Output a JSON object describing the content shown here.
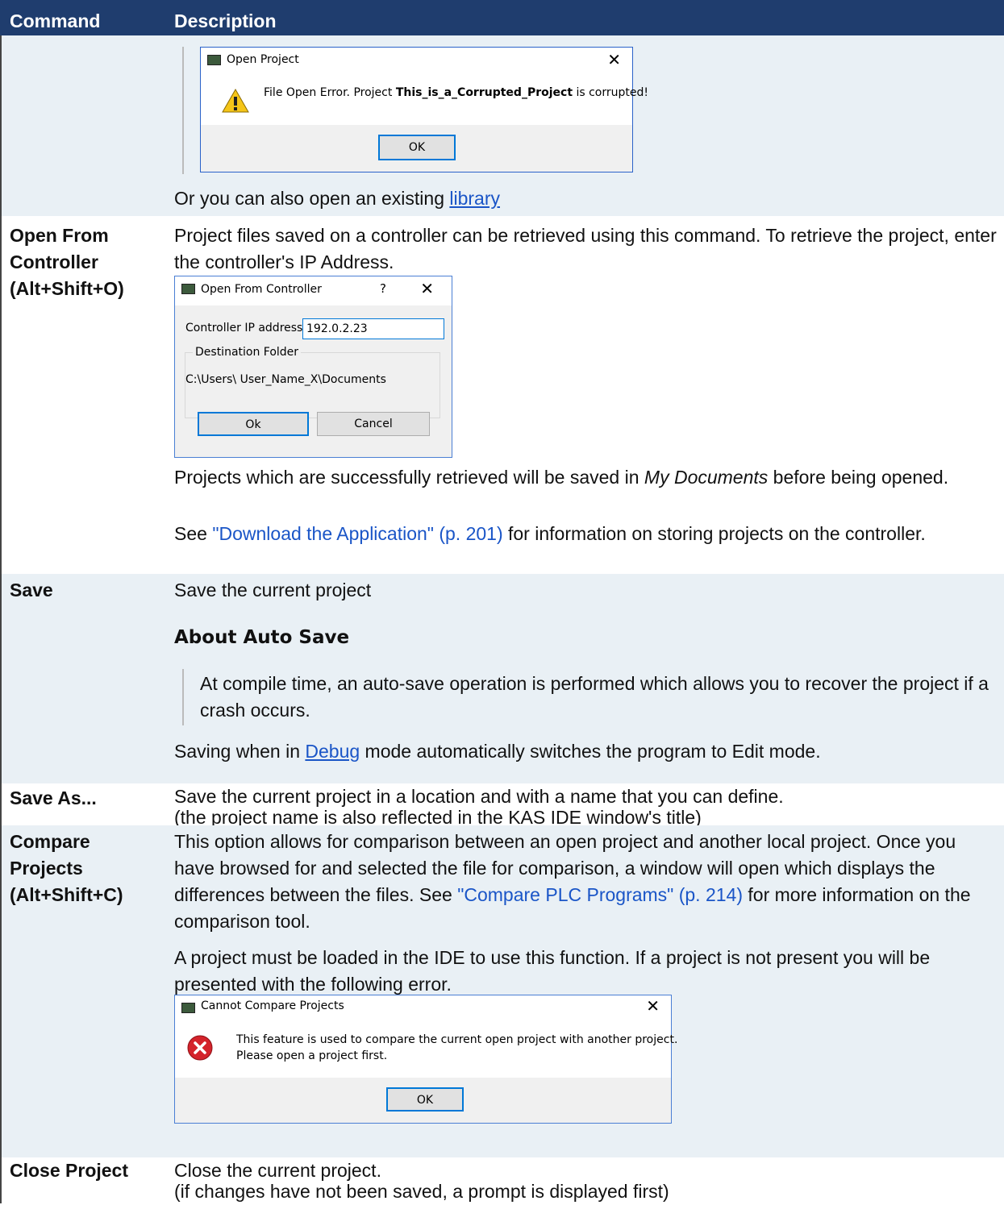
{
  "header": {
    "command": "Command",
    "description": "Description"
  },
  "rows": {
    "open": {
      "dialog": {
        "title": "Open Project",
        "message_pre": "File Open Error. Project ",
        "message_bold": "This_is_a_Corrupted_Project",
        "message_post": " is corrupted!",
        "ok": "OK",
        "close": "✕"
      },
      "library_pre": "Or you can also open an existing ",
      "library_link": "library"
    },
    "open_from_controller": {
      "command": "Open From Controller (Alt+Shift+O)",
      "text1": "Project files saved on a controller can be retrieved using this command. To retrieve the project, enter the controller's IP Address.",
      "dialog": {
        "title": "Open From Controller",
        "help": "?",
        "close": "✕",
        "ip_label": "Controller IP address:",
        "ip_value": "192.0.2.23",
        "group_label": "Destination Folder",
        "path": "C:\\Users\\ User_Name_X\\Documents",
        "ok": "Ok",
        "cancel": "Cancel"
      },
      "text2_pre": "Projects which are successfully retrieved will be saved in ",
      "text2_em": "My Documents",
      "text2_post": " before being opened.",
      "text3_pre": "See ",
      "text3_link": "\"Download the Application\" (p. 201)",
      "text3_post": " for information on storing projects on the controller."
    },
    "save": {
      "command": "Save",
      "text1": "Save the current project",
      "heading": "About Auto Save",
      "quote": "At compile time, an auto-save operation is performed which allows you to recover the project if a crash occurs.",
      "text2_pre": "Saving when in ",
      "text2_link": "Debug",
      "text2_post": " mode automatically switches the program to Edit mode."
    },
    "save_as": {
      "command": "Save As...",
      "text1": "Save the current project in a location and with a name that you can define.",
      "text2": "(the project name is also reflected in the KAS IDE window's title)"
    },
    "compare": {
      "command": "Compare Projects (Alt+Shift+C)",
      "text1_pre": "This option allows for comparison between an open project and another local project. Once you have browsed for and selected the file for comparison, a window will open which displays the differences between the files. See ",
      "text1_link": "\"Compare PLC Programs\" (p. 214)",
      "text1_post": " for more information on the comparison tool.",
      "text2": "A project must be loaded in the IDE to use this function. If a project is not present you will be presented with the following error.",
      "dialog": {
        "title": "Cannot Compare Projects",
        "close": "✕",
        "line1": "This feature is used to compare the current open project with another project.",
        "line2": "Please open a project first.",
        "ok": "OK"
      }
    },
    "close": {
      "command": "Close Project",
      "text1": "Close the current project.",
      "text2": "(if changes have not been saved, a prompt is displayed first)"
    }
  }
}
